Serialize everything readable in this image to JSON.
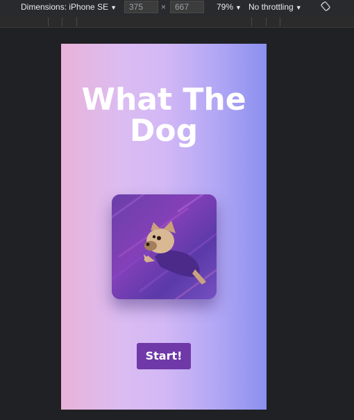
{
  "devtools": {
    "dimensions_label": "Dimensions: iPhone SE",
    "width_value": "375",
    "times_symbol": "×",
    "height_value": "667",
    "zoom_label": "79%",
    "throttle_label": "No throttling",
    "caret": "▼",
    "rotate_icon": "rotate-icon"
  },
  "page": {
    "title_line1": "What The",
    "title_line2": "Dog",
    "hero_image": "flying-french-bulldog-in-purple-shirt",
    "start_label": "Start!"
  },
  "colors": {
    "gradient_left": "#e9b3d9",
    "gradient_mid": "#d3b8f5",
    "gradient_right": "#8a90ef",
    "button_bg": "#6f39a8",
    "title_color": "#ffffff",
    "devtools_bg": "#202124"
  }
}
